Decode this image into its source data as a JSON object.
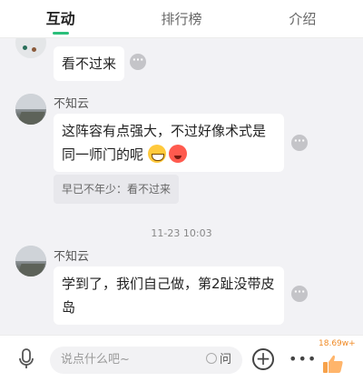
{
  "tabs": [
    {
      "label": "互动"
    },
    {
      "label": "排行榜"
    },
    {
      "label": "介绍"
    }
  ],
  "messages": [
    {
      "text": "看不过来"
    },
    {
      "name": "不知云",
      "text": "这阵容有点强大，不过好像术式是同一师门的呢",
      "emoji": [
        "grin-icon",
        "heart-eyes-icon"
      ],
      "quote": "早已不年少：看不过来"
    },
    {
      "name": "不知云",
      "text": "学到了，我们自己做，第2趾没带皮岛"
    }
  ],
  "timestamp": "11-23 10:03",
  "bottom": {
    "placeholder": "说点什么吧~",
    "ask_label": "问",
    "like_count": "18.69w+"
  },
  "colors": {
    "accent": "#2bbf7a",
    "like": "#f08a24"
  }
}
